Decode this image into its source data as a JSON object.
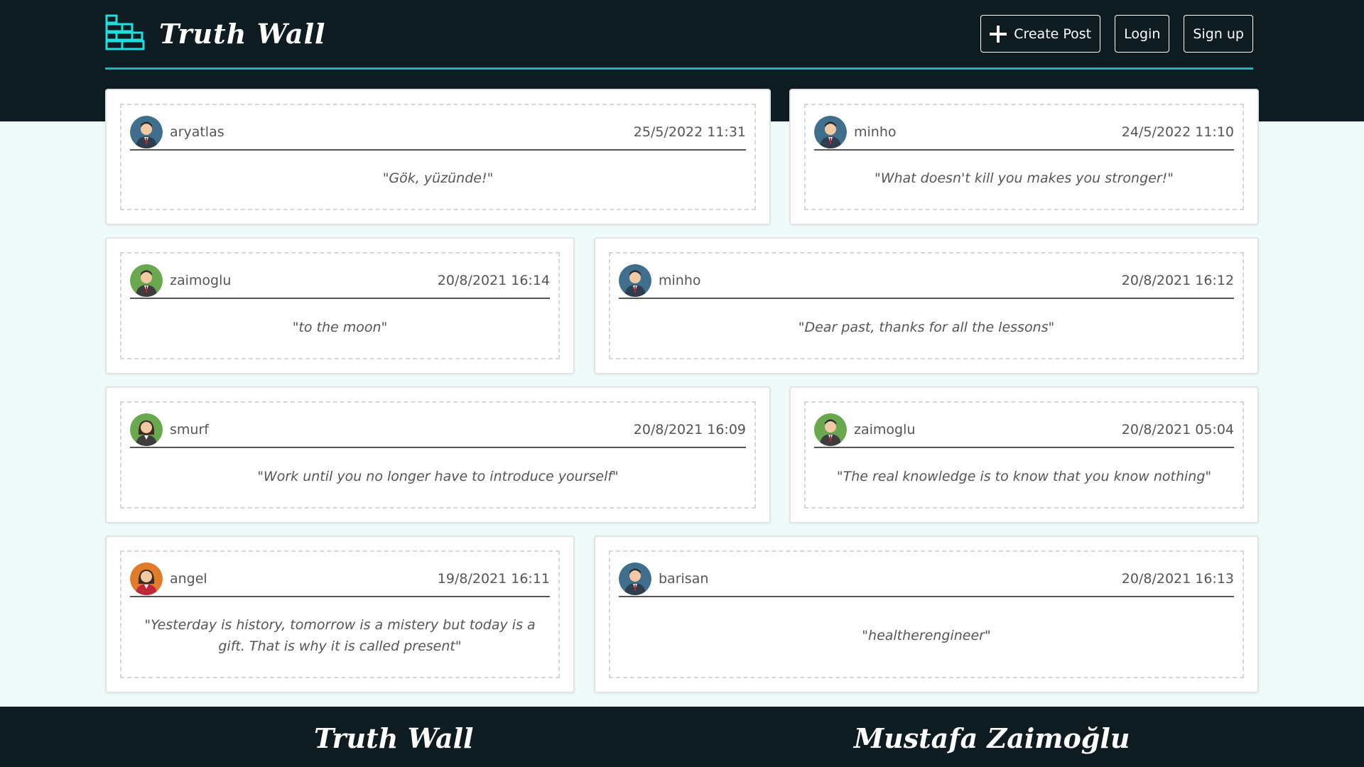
{
  "header": {
    "brand": "Truth Wall",
    "buttons": {
      "create_post": "Create Post",
      "login": "Login",
      "signup": "Sign up"
    }
  },
  "posts": [
    {
      "username": "aryatlas",
      "date": "25/5/2022 11:31",
      "quote": "\"Gök, yüzünde!\"",
      "avatar": "man-blue"
    },
    {
      "username": "minho",
      "date": "24/5/2022 11:10",
      "quote": "\"What doesn't kill you makes you stronger!\"",
      "avatar": "man-blue"
    },
    {
      "username": "zaimoglu",
      "date": "20/8/2021 16:14",
      "quote": "\"to the moon\"",
      "avatar": "man-green"
    },
    {
      "username": "minho",
      "date": "20/8/2021 16:12",
      "quote": "\"Dear past, thanks for all the lessons\"",
      "avatar": "man-blue"
    },
    {
      "username": "smurf",
      "date": "20/8/2021 16:09",
      "quote": "\"Work until you no longer have to introduce yourself\"",
      "avatar": "woman-green"
    },
    {
      "username": "zaimoglu",
      "date": "20/8/2021 05:04",
      "quote": "\"The real knowledge is to know that you know nothing\"",
      "avatar": "man-green"
    },
    {
      "username": "angel",
      "date": "19/8/2021 16:11",
      "quote": "\"Yesterday is history, tomorrow is a mistery but today is a gift. That is why it is called present\"",
      "avatar": "woman-orange"
    },
    {
      "username": "barisan",
      "date": "20/8/2021 16:13",
      "quote": "\"healtherengineer\"",
      "avatar": "man-blue"
    }
  ],
  "footer": {
    "brand": "Truth Wall",
    "author": "Mustafa Zaimoğlu"
  },
  "colors": {
    "navbar_bg": "#0e1c21",
    "accent": "#1fb3b8",
    "page_bg": "#effbfa"
  }
}
